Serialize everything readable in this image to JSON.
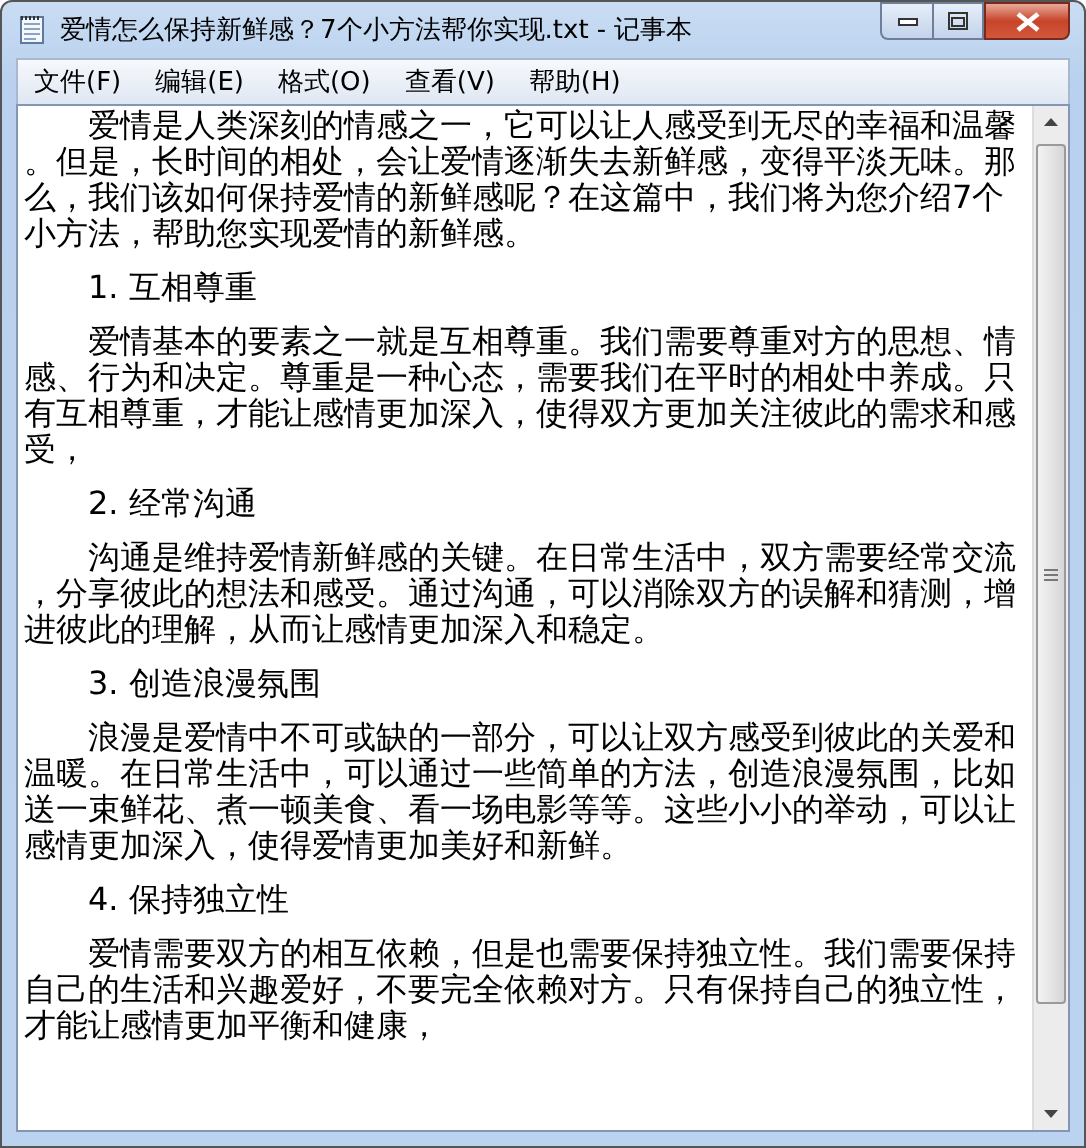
{
  "window": {
    "title": "爱情怎么保持新鲜感？7个小方法帮你实现.txt - 记事本"
  },
  "menu": [
    "文件(F)",
    "编辑(E)",
    "格式(O)",
    "查看(V)",
    "帮助(H)"
  ],
  "intro": "爱情是人类深刻的情感之一，它可以让人感受到无尽的幸福和温馨。但是，长时间的相处，会让爱情逐渐失去新鲜感，变得平淡无味。那么，我们该如何保持爱情的新鲜感呢？在这篇中，我们将为您介绍7个小方法，帮助您实现爱情的新鲜感。",
  "sections": [
    {
      "heading": "1. 互相尊重",
      "text": "爱情基本的要素之一就是互相尊重。我们需要尊重对方的思想、情感、行为和决定。尊重是一种心态，需要我们在平时的相处中养成。只有互相尊重，才能让感情更加深入，使得双方更加关注彼此的需求和感受，"
    },
    {
      "heading": "2. 经常沟通",
      "text": "沟通是维持爱情新鲜感的关键。在日常生活中，双方需要经常交流，分享彼此的想法和感受。通过沟通，可以消除双方的误解和猜测，增进彼此的理解，从而让感情更加深入和稳定。"
    },
    {
      "heading": "3. 创造浪漫氛围",
      "text": "浪漫是爱情中不可或缺的一部分，可以让双方感受到彼此的关爱和温暖。在日常生活中，可以通过一些简单的方法，创造浪漫氛围，比如送一束鲜花、煮一顿美食、看一场电影等等。这些小小的举动，可以让感情更加深入，使得爱情更加美好和新鲜。"
    },
    {
      "heading": "4. 保持独立性",
      "text": "爱情需要双方的相互依赖，但是也需要保持独立性。我们需要保持自己的生活和兴趣爱好，不要完全依赖对方。只有保持自己的独立性，才能让感情更加平衡和健康，"
    }
  ]
}
